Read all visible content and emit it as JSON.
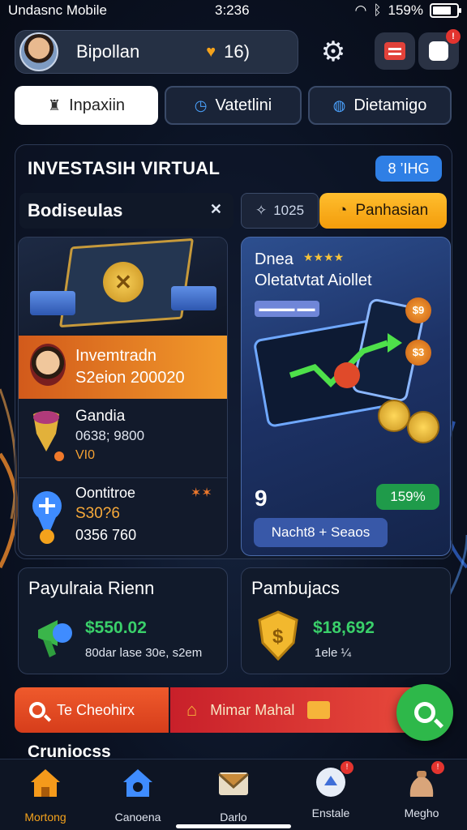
{
  "status_bar": {
    "carrier": "Undasnc Mobile",
    "time": "3:236",
    "battery": "159%"
  },
  "header": {
    "username": "Bipollan",
    "heart_count": "16)",
    "notif_badge": "!",
    "msg_badge": ""
  },
  "tabs": [
    {
      "label": "Inpaxiin",
      "icon": "trophy-icon",
      "active": true
    },
    {
      "label": "Vatetlini",
      "icon": "clock-icon",
      "active": false
    },
    {
      "label": "Dietamigo",
      "icon": "globe-icon",
      "active": false
    }
  ],
  "panel": {
    "title": "INVESTASIH VIRTUAL",
    "pill": "8 ’IHG",
    "subbar_title": "Bodiseulas",
    "chip_label": "1025",
    "orange_button": "Panhasian"
  },
  "left_card": {
    "row_a": {
      "line1": "Invemtradn",
      "line2": "S2eion 200020"
    },
    "row_b": {
      "line1": "Gandia",
      "line2": "0638; 9800",
      "line3": "VI0"
    },
    "row_c": {
      "line1": "Oontitroe",
      "line2": "S30?6",
      "line3": "0356 760",
      "stars": "✶✶"
    }
  },
  "right_card": {
    "line1": "Dnea",
    "stars": "★★★★",
    "line2": "Oletatvtat Aiollet",
    "mini_tag": "▬▬▬▬ ▬▬",
    "orb1": "$9",
    "orb2": "$3",
    "pin": "9",
    "percent": "159%",
    "button": "Nacht8 + Seaos"
  },
  "stats": [
    {
      "title": "Payulraia Rienn",
      "value": "$550.02",
      "sub": "80dar lase 30e, s2em"
    },
    {
      "title": "Pambujacs",
      "value": "$18,692",
      "sub": "1ele  ¼"
    }
  ],
  "actions": {
    "left_label": "Te Cheohirx",
    "right_label": "Mimar Mahal"
  },
  "section_title": "Cruniocss",
  "bottom_nav": [
    {
      "label": "Mortong",
      "icon": "home-icon",
      "active": true
    },
    {
      "label": "Canoena",
      "icon": "house-icon",
      "active": false
    },
    {
      "label": "Darlo",
      "icon": "envelope-icon",
      "active": false,
      "badge": ""
    },
    {
      "label": "Enstale",
      "icon": "shield-icon",
      "active": false,
      "badge": "!"
    },
    {
      "label": "Megho",
      "icon": "pouch-icon",
      "active": false,
      "badge": "!"
    }
  ],
  "colors": {
    "accent_orange": "#f39c0b",
    "accent_blue": "#2f7fe5",
    "accent_green": "#2eb84a",
    "accent_red": "#d63d1b"
  }
}
